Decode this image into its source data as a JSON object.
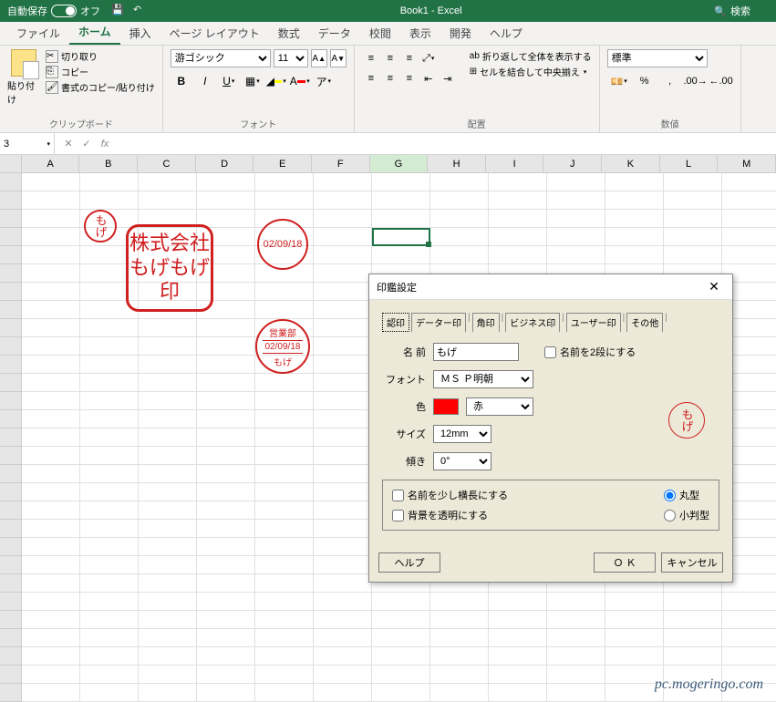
{
  "titlebar": {
    "autosave_label": "自動保存",
    "autosave_state": "オフ",
    "title": "Book1 - Excel",
    "search_placeholder": "検索"
  },
  "tabs": {
    "file": "ファイル",
    "home": "ホーム",
    "insert": "挿入",
    "layout": "ページ レイアウト",
    "formulas": "数式",
    "data": "データ",
    "review": "校閲",
    "view": "表示",
    "developer": "開発",
    "help": "ヘルプ"
  },
  "ribbon": {
    "clipboard": {
      "paste": "貼り付け",
      "cut": "切り取り",
      "copy": "コピー",
      "fmtpaint": "書式のコピー/貼り付け",
      "label": "クリップボード"
    },
    "font": {
      "name": "游ゴシック",
      "size": "11",
      "label": "フォント",
      "bold": "B",
      "italic": "I",
      "underline": "U",
      "fontletter": "A"
    },
    "align": {
      "wrap": "折り返して全体を表示する",
      "merge": "セルを結合して中央揃え",
      "label": "配置"
    },
    "number": {
      "format": "標準",
      "label": "数値"
    }
  },
  "namebox": "3",
  "fx": "fx",
  "columns": [
    "A",
    "B",
    "C",
    "D",
    "E",
    "F",
    "G",
    "H",
    "I",
    "J",
    "K",
    "L",
    "M"
  ],
  "stamps": {
    "s1": "もげ",
    "s2": "株式会社もげもげ印",
    "s3": "02/09/18",
    "s4_top": "営業部",
    "s4_mid": "02/09/18",
    "s4_bot": "もげ"
  },
  "dialog": {
    "title": "印鑑設定",
    "tabs": {
      "t1": "認印",
      "t2": "データー印",
      "t3": "角印",
      "t4": "ビジネス印",
      "t5": "ユーザー印",
      "t6": "その他"
    },
    "name_lbl": "名 前",
    "name_val": "もげ",
    "two_lines": "名前を2段にする",
    "font_lbl": "フォント",
    "font_val": "ＭＳ Ｐ明朝",
    "color_lbl": "色",
    "color_val": "赤",
    "size_lbl": "サイズ",
    "size_val": "12mm",
    "angle_lbl": "傾き",
    "angle_val": "0°",
    "wide": "名前を少し横長にする",
    "transparent": "背景を透明にする",
    "round": "丸型",
    "oval": "小判型",
    "help": "ヘルプ",
    "ok": "Ｏ Ｋ",
    "cancel": "キャンセル",
    "preview": "もげ"
  },
  "watermark": "pc.mogeringo.com"
}
